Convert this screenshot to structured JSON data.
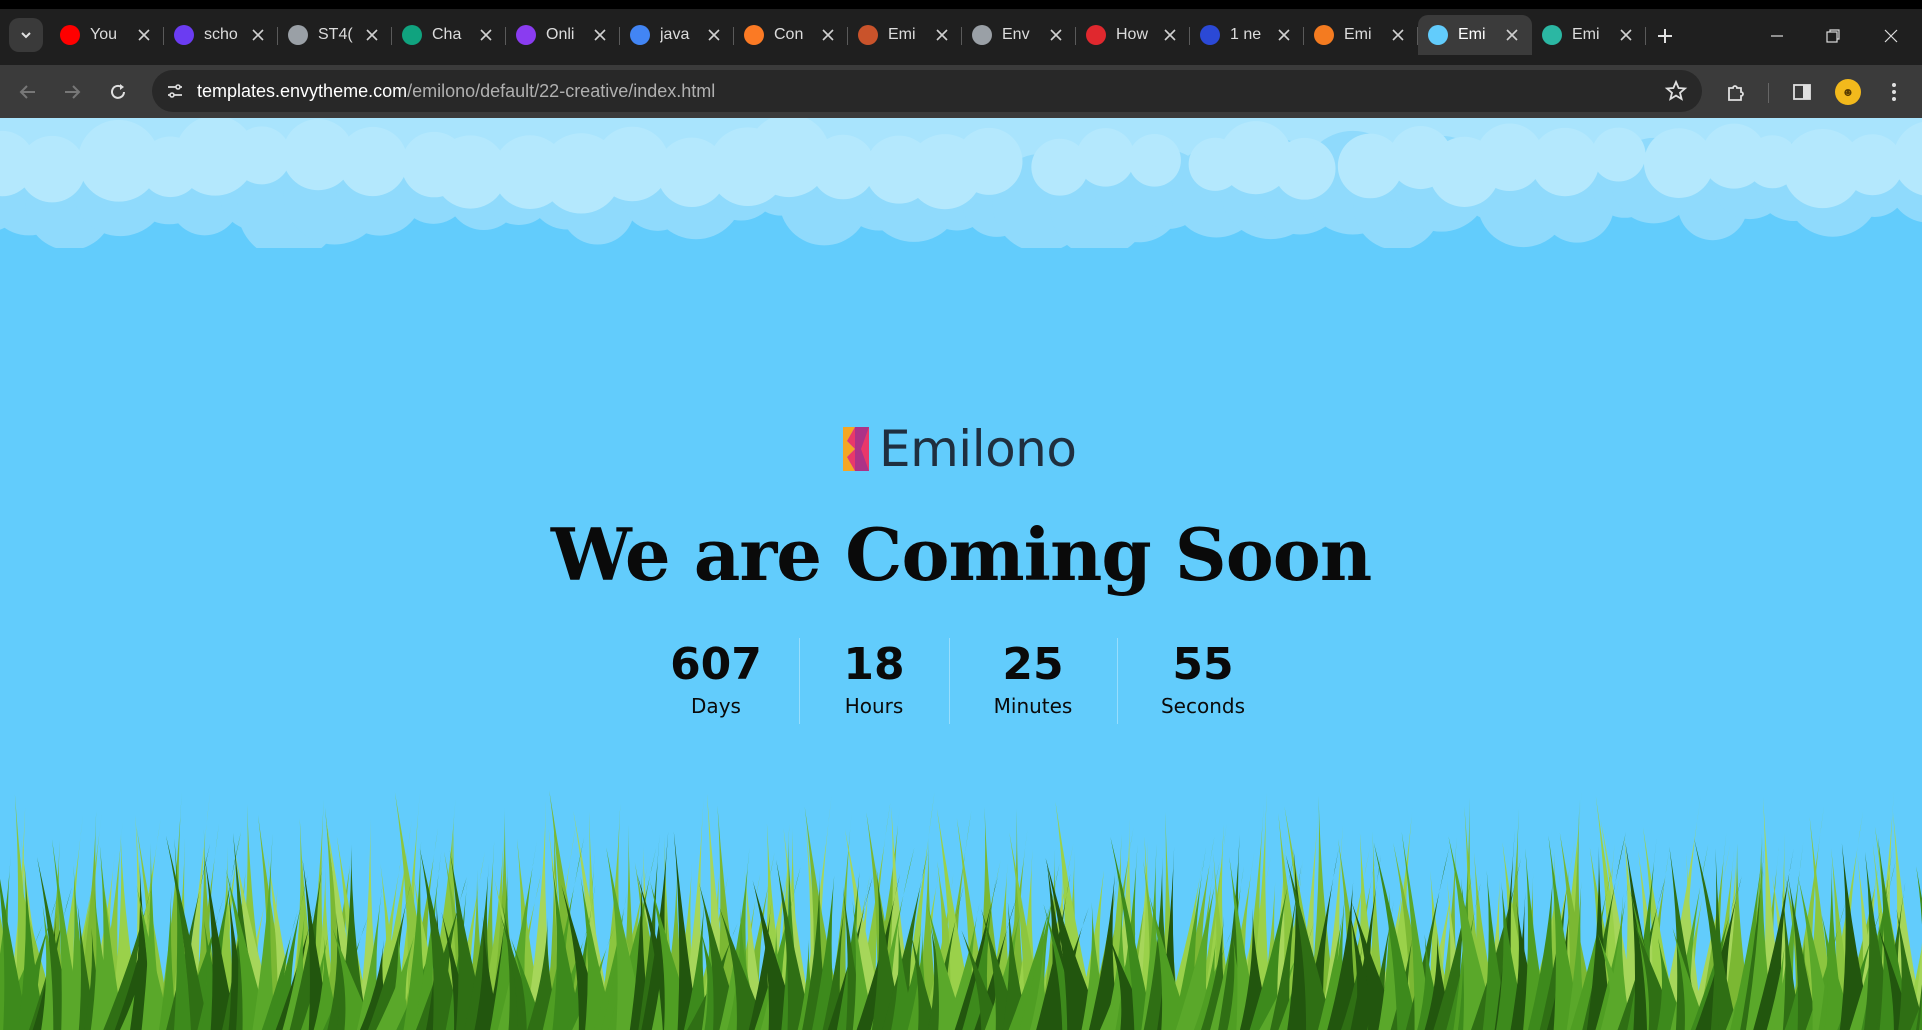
{
  "browser": {
    "tabs": [
      {
        "title": "You",
        "icon": "youtube-icon",
        "color": "#ff0000"
      },
      {
        "title": "scho",
        "icon": "shield-cat-icon",
        "color": "#6b3cf2"
      },
      {
        "title": "ST4(",
        "icon": "globe-icon",
        "color": "#9aa0a6"
      },
      {
        "title": "Cha",
        "icon": "chatgpt-icon",
        "color": "#10a37f"
      },
      {
        "title": "Onli",
        "icon": "p-logo-icon",
        "color": "#8a3cf0"
      },
      {
        "title": "java",
        "icon": "google-icon",
        "color": "#4285f4"
      },
      {
        "title": "Con",
        "icon": "xampp-icon",
        "color": "#fb7a24"
      },
      {
        "title": "Emi",
        "icon": "building-icon",
        "color": "#c9532b"
      },
      {
        "title": "Env",
        "icon": "globe-icon",
        "color": "#9aa0a6"
      },
      {
        "title": "How",
        "icon": "red-bars-icon",
        "color": "#e0282e"
      },
      {
        "title": "1 ne",
        "icon": "et-icon",
        "color": "#2b49d6"
      },
      {
        "title": "Emi",
        "icon": "orange-x-icon",
        "color": "#f47b20"
      },
      {
        "title": "Emi",
        "icon": "pin-icon",
        "color": "#62ccfc",
        "active": true
      },
      {
        "title": "Emi",
        "icon": "colorful-circle-icon",
        "color": "#2bb7a3"
      }
    ],
    "url_host": "templates.envytheme.com",
    "url_path": "/emilono/default/22-creative/index.html"
  },
  "page": {
    "logo_text": "Emilono",
    "headline": "We are Coming Soon",
    "countdown": [
      {
        "value": "607",
        "label": "Days"
      },
      {
        "value": "18",
        "label": "Hours"
      },
      {
        "value": "25",
        "label": "Minutes"
      },
      {
        "value": "55",
        "label": "Seconds"
      }
    ],
    "colors": {
      "sky": "#62ccfc",
      "cloud_light": "#a9e4fd",
      "cloud_dark": "#8fdafc",
      "grass_dark": "#2f6f14",
      "grass_light": "#8cc63f"
    }
  }
}
